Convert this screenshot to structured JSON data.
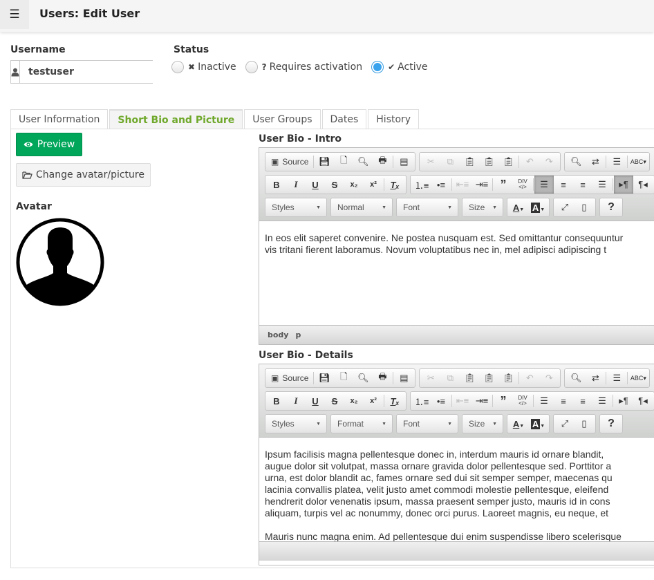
{
  "header": {
    "title": "Users: Edit User",
    "menu_icon": "hamburger-icon"
  },
  "username": {
    "label": "Username",
    "value": "testuser",
    "icon": "user-icon"
  },
  "status": {
    "label": "Status",
    "options": [
      {
        "glyph": "✖",
        "label": "Inactive",
        "checked": false
      },
      {
        "glyph": "?",
        "label": "Requires activation",
        "checked": false
      },
      {
        "glyph": "✔",
        "label": "Active",
        "checked": true
      }
    ]
  },
  "tabs": [
    {
      "label": "User Information",
      "active": false
    },
    {
      "label": "Short Bio and Picture",
      "active": true
    },
    {
      "label": "User Groups",
      "active": false
    },
    {
      "label": "Dates",
      "active": false
    },
    {
      "label": "History",
      "active": false
    }
  ],
  "left": {
    "preview_label": "Preview",
    "change_avatar_label": "Change avatar/picture",
    "avatar_label": "Avatar"
  },
  "toolbar": {
    "source_label": "Source",
    "combos_intro": {
      "styles": "Styles",
      "format": "Normal",
      "font": "Font",
      "size": "Size"
    },
    "combos_details": {
      "styles": "Styles",
      "format": "Format",
      "font": "Font",
      "size": "Size"
    }
  },
  "editor_intro": {
    "label": "User Bio - Intro",
    "paragraphs": [
      "In eos elit saperet convenire. Ne postea nusquam est. Sed omittantur consequuntur",
      "vis tritani fierent laboramus. Novum voluptatibus nec in, mel adipisci adipiscing t"
    ],
    "path": [
      "body",
      "p"
    ]
  },
  "editor_details": {
    "label": "User Bio - Details",
    "lines": [
      "Ipsum facilisis magna pellentesque donec in, interdum mauris id ornare blandit,",
      "augue dolor sit volutpat, massa ornare gravida dolor pellentesque sed. Porttitor a",
      "urna, est dolor blandit ac, fames ornare sed dui sit semper semper, maecenas qu",
      "lacinia convallis platea, velit justo amet commodi molestie pellentesque, eleifend",
      "hendrerit dolor venenatis ipsum, massa praesent semper justo, mauris id in cons",
      "aliquam, turpis vel ac nonummy, donec orci purus. Laoreet magnis, eu neque, et"
    ],
    "second_paragraph": "Mauris nunc magna enim. Ad pellentesque dui enim suspendisse libero scelerisque"
  }
}
